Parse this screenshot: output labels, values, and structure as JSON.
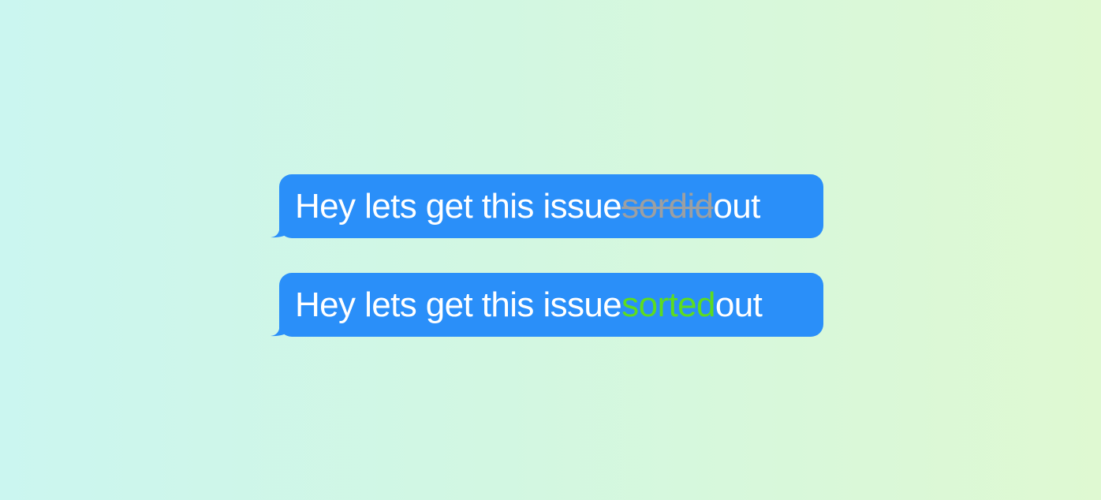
{
  "messages": [
    {
      "prefix": "Hey lets get this issue ",
      "highlight": "sordid",
      "suffix": " out",
      "style": "strikethrough"
    },
    {
      "prefix": "Hey lets get this issue ",
      "highlight": "sorted",
      "suffix": " out",
      "style": "corrected"
    }
  ],
  "colors": {
    "bubble": "#2a8ff9",
    "text": "#ffffff",
    "strikethrough": "#9c9fa2",
    "corrected": "#5ddc1f",
    "background_left": "#cbf6f0",
    "background_right": "#dff9d2"
  }
}
